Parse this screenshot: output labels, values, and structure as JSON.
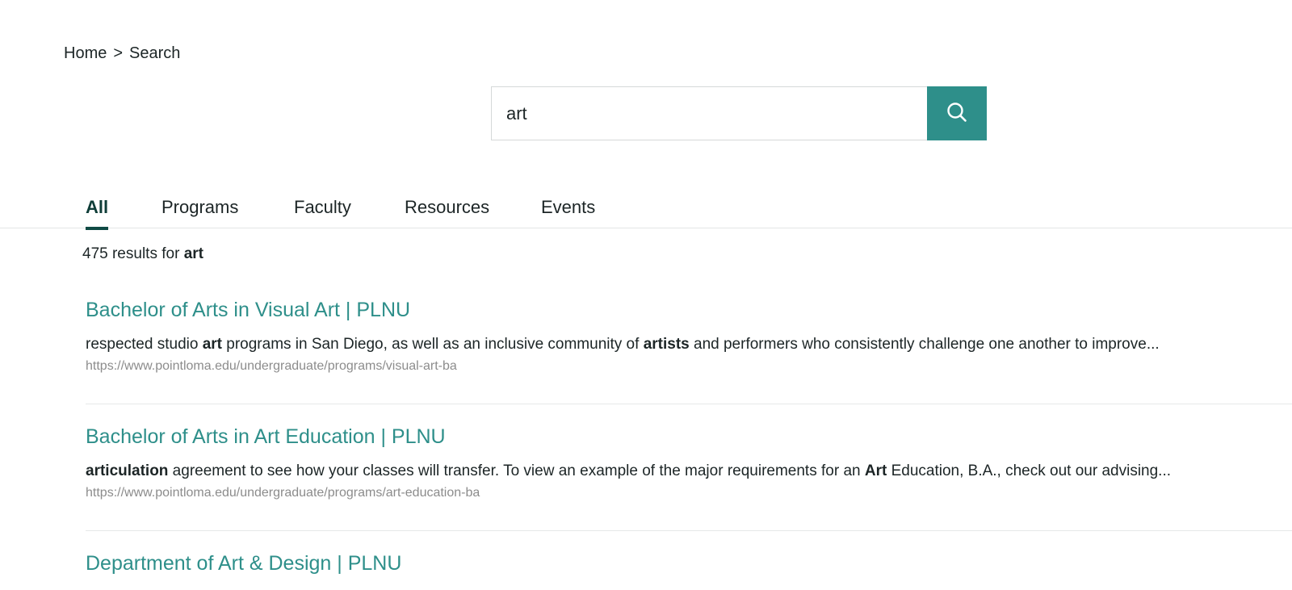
{
  "breadcrumb": {
    "home": "Home",
    "separator": ">",
    "current": "Search"
  },
  "search": {
    "value": "art",
    "button_icon": "search-icon"
  },
  "tabs": [
    {
      "label": "All",
      "active": true
    },
    {
      "label": "Programs",
      "active": false
    },
    {
      "label": "Faculty",
      "active": false
    },
    {
      "label": "Resources",
      "active": false
    },
    {
      "label": "Events",
      "active": false
    }
  ],
  "results_summary": {
    "count_text": "475 results for",
    "query": "art"
  },
  "results": [
    {
      "title": "Bachelor of Arts in Visual Art | PLNU",
      "snippet": [
        {
          "t": "respected studio ",
          "b": false
        },
        {
          "t": "art",
          "b": true
        },
        {
          "t": " programs in San Diego, as well as an inclusive community of ",
          "b": false
        },
        {
          "t": "artists",
          "b": true
        },
        {
          "t": " and performers who consistently challenge one another to improve...",
          "b": false
        }
      ],
      "url": "https://www.pointloma.edu/undergraduate/programs/visual-art-ba"
    },
    {
      "title": "Bachelor of Arts in Art Education | PLNU",
      "snippet": [
        {
          "t": "articulation",
          "b": true
        },
        {
          "t": " agreement to see how your classes will transfer. To view an example of the major requirements for an ",
          "b": false
        },
        {
          "t": "Art",
          "b": true
        },
        {
          "t": " Education, B.A., check out our advising...",
          "b": false
        }
      ],
      "url": "https://www.pointloma.edu/undergraduate/programs/art-education-ba"
    },
    {
      "title": "Department of Art & Design | PLNU",
      "snippet": [],
      "url": ""
    }
  ],
  "colors": {
    "accent": "#2e8f8a",
    "active_tab": "#0f4a44",
    "url": "#8c8c8c"
  }
}
